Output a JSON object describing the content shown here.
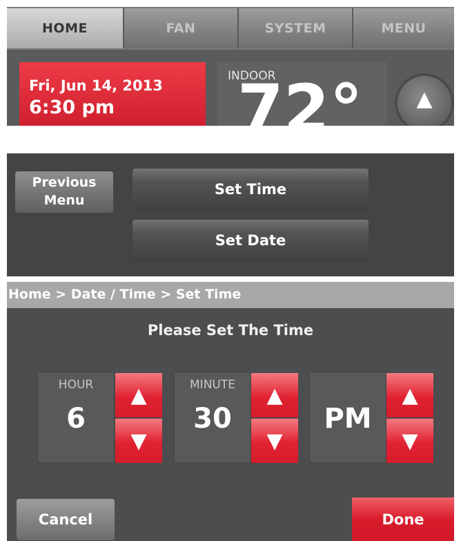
{
  "home": {
    "tabs": [
      {
        "label": "HOME",
        "active": true
      },
      {
        "label": "FAN",
        "active": false
      },
      {
        "label": "SYSTEM",
        "active": false
      },
      {
        "label": "MENU",
        "active": false
      }
    ],
    "date": "Fri, Jun 14, 2013",
    "time": "6:30 pm",
    "indoor_label": "INDOOR",
    "indoor_value": "72°",
    "up_icon": "triangle-up-icon",
    "accent_color": "#e02232"
  },
  "menu": {
    "previous_line1": "Previous",
    "previous_line2": "Menu",
    "set_time": "Set Time",
    "set_date": "Set Date"
  },
  "set_time": {
    "breadcrumb": "Home > Date / Time > Set Time",
    "heading": "Please Set The Time",
    "hour_label": "HOUR",
    "hour_value": "6",
    "minute_label": "MINUTE",
    "minute_value": "30",
    "ampm_value": "PM",
    "up_arrow": "▲",
    "down_arrow": "▼",
    "cancel": "Cancel",
    "done": "Done"
  }
}
